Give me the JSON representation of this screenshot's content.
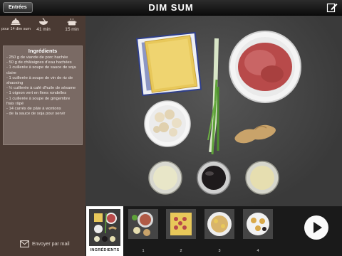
{
  "header": {
    "title": "DIM SUM",
    "back_label": "Entrées",
    "edit_icon": "edit-icon"
  },
  "meta": {
    "servings": "pour 14 dim sum",
    "prep_time": "41 min",
    "cook_time": "15 min"
  },
  "ingredients": {
    "title": "Ingrédients",
    "items": [
      "- 250 g de viande de porc hachée",
      "- 50 g de châtaignes d'eau hachées",
      "- 1 cuillerée à soupe de sauce de soja",
      "claire",
      "- 1 cuillerée à soupe de vin de riz de",
      "shaoxing",
      "- ½ cuillerée à café d'huile de sésame",
      "- 1 oignon vert en fines rondelles",
      "- 1 cuillerée à soupe de gingembre",
      "frais râpé",
      "- 14 carrés de pâte à wontons",
      "- de la sauce de soja pour servir"
    ]
  },
  "share": {
    "label": "Envoyer par mail"
  },
  "steps": {
    "active_label": "INGRÉDIENTS",
    "labels": [
      "1",
      "2",
      "3",
      "4"
    ]
  },
  "colors": {
    "panel": "#4a3a33",
    "ingredients_box": "#7a6a64",
    "accent_white": "#ffffff"
  }
}
